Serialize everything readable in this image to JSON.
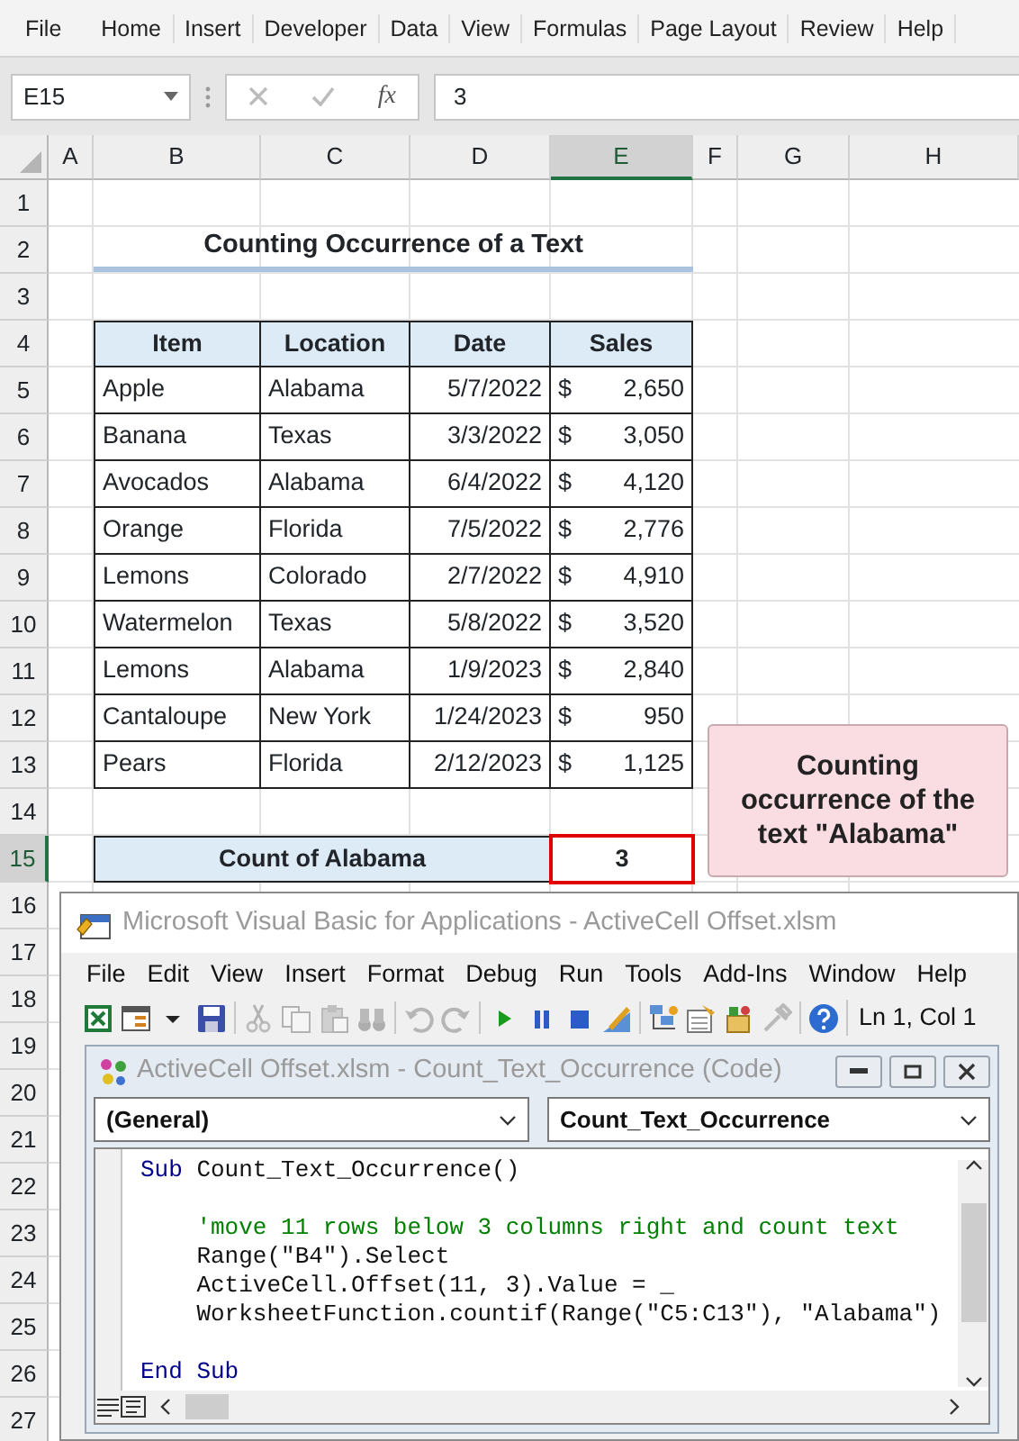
{
  "ribbon_tabs": [
    "File",
    "Home",
    "Insert",
    "Developer",
    "Data",
    "View",
    "Formulas",
    "Page Layout",
    "Review",
    "Help"
  ],
  "formula_bar": {
    "name_box": "E15",
    "fx": "fx",
    "value": "3"
  },
  "columns": [
    {
      "label": "A",
      "selected": false
    },
    {
      "label": "B",
      "selected": false
    },
    {
      "label": "C",
      "selected": false
    },
    {
      "label": "D",
      "selected": false
    },
    {
      "label": "E",
      "selected": true
    },
    {
      "label": "F",
      "selected": false
    },
    {
      "label": "G",
      "selected": false
    },
    {
      "label": "H",
      "selected": false
    }
  ],
  "rows": [
    {
      "label": "1",
      "selected": false
    },
    {
      "label": "2",
      "selected": false
    },
    {
      "label": "3",
      "selected": false
    },
    {
      "label": "4",
      "selected": false
    },
    {
      "label": "5",
      "selected": false
    },
    {
      "label": "6",
      "selected": false
    },
    {
      "label": "7",
      "selected": false
    },
    {
      "label": "8",
      "selected": false
    },
    {
      "label": "9",
      "selected": false
    },
    {
      "label": "10",
      "selected": false
    },
    {
      "label": "11",
      "selected": false
    },
    {
      "label": "12",
      "selected": false
    },
    {
      "label": "13",
      "selected": false
    },
    {
      "label": "14",
      "selected": false
    },
    {
      "label": "15",
      "selected": true
    },
    {
      "label": "16",
      "selected": false
    },
    {
      "label": "17",
      "selected": false
    },
    {
      "label": "18",
      "selected": false
    },
    {
      "label": "19",
      "selected": false
    },
    {
      "label": "20",
      "selected": false
    },
    {
      "label": "21",
      "selected": false
    },
    {
      "label": "22",
      "selected": false
    },
    {
      "label": "23",
      "selected": false
    },
    {
      "label": "24",
      "selected": false
    },
    {
      "label": "25",
      "selected": false
    },
    {
      "label": "26",
      "selected": false
    },
    {
      "label": "27",
      "selected": false
    }
  ],
  "sheet_title": "Counting Occurrence of a Text",
  "table": {
    "columns": [
      "Item",
      "Location",
      "Date",
      "Sales"
    ],
    "rows": [
      {
        "item": "Apple",
        "location": "Alabama",
        "date": "5/7/2022",
        "currency": "$",
        "amount": "2,650"
      },
      {
        "item": "Banana",
        "location": "Texas",
        "date": "3/3/2022",
        "currency": "$",
        "amount": "3,050"
      },
      {
        "item": "Avocados",
        "location": "Alabama",
        "date": "6/4/2022",
        "currency": "$",
        "amount": "4,120"
      },
      {
        "item": "Orange",
        "location": "Florida",
        "date": "7/5/2022",
        "currency": "$",
        "amount": "2,776"
      },
      {
        "item": "Lemons",
        "location": "Colorado",
        "date": "2/7/2022",
        "currency": "$",
        "amount": "4,910"
      },
      {
        "item": "Watermelon",
        "location": "Texas",
        "date": "5/8/2022",
        "currency": "$",
        "amount": "3,520"
      },
      {
        "item": "Lemons",
        "location": "Alabama",
        "date": "1/9/2023",
        "currency": "$",
        "amount": "2,840"
      },
      {
        "item": "Cantaloupe",
        "location": "New York",
        "date": "1/24/2023",
        "currency": "$",
        "amount": "950"
      },
      {
        "item": "Pears",
        "location": "Florida",
        "date": "2/12/2023",
        "currency": "$",
        "amount": "1,125"
      }
    ]
  },
  "summary": {
    "label": "Count of Alabama",
    "value": "3"
  },
  "callout": "Counting occurrence of the text \"Alabama\"",
  "vba_window": {
    "title": "Microsoft Visual Basic for Applications - ActiveCell Offset.xlsm",
    "menu": [
      "File",
      "Edit",
      "View",
      "Insert",
      "Format",
      "Debug",
      "Run",
      "Tools",
      "Add-Ins",
      "Window",
      "Help"
    ],
    "toolbar": [
      [
        {
          "kind": "excel",
          "disabled": false
        },
        {
          "kind": "form",
          "disabled": false
        },
        {
          "kind": "caret",
          "disabled": false
        },
        {
          "kind": "save",
          "disabled": false
        }
      ],
      [
        {
          "kind": "cut",
          "disabled": true
        },
        {
          "kind": "copy",
          "disabled": true
        },
        {
          "kind": "paste",
          "disabled": true
        },
        {
          "kind": "find",
          "disabled": true
        }
      ],
      [
        {
          "kind": "undo",
          "disabled": true
        },
        {
          "kind": "redo",
          "disabled": true
        }
      ],
      [
        {
          "kind": "run",
          "disabled": false
        },
        {
          "kind": "pause",
          "disabled": false
        },
        {
          "kind": "stop",
          "disabled": false
        },
        {
          "kind": "design",
          "disabled": false
        }
      ],
      [
        {
          "kind": "project",
          "disabled": false
        },
        {
          "kind": "properties",
          "disabled": false
        },
        {
          "kind": "browser",
          "disabled": false
        },
        {
          "kind": "toolbox",
          "disabled": true
        }
      ],
      [
        {
          "kind": "help",
          "disabled": false
        }
      ]
    ],
    "position": "Ln 1, Col 1",
    "code_window": {
      "title": "ActiveCell Offset.xlsm - Count_Text_Occurrence (Code)",
      "object": "(General)",
      "procedure": "Count_Text_Occurrence",
      "lines": [
        {
          "kind": "code",
          "tokens": [
            {
              "text": "Sub",
              "kind": "keyword"
            },
            {
              "text": " Count_Text_Occurrence()",
              "kind": "plain"
            }
          ]
        },
        {
          "kind": "blank"
        },
        {
          "kind": "code",
          "tokens": [
            {
              "text": "    'move 11 rows below 3 columns right and count text",
              "kind": "comment"
            }
          ]
        },
        {
          "kind": "code",
          "tokens": [
            {
              "text": "    Range(\"B4\").Select",
              "kind": "plain"
            }
          ]
        },
        {
          "kind": "code",
          "tokens": [
            {
              "text": "    ActiveCell.Offset(11, 3).Value = _",
              "kind": "plain"
            }
          ]
        },
        {
          "kind": "code",
          "tokens": [
            {
              "text": "    WorksheetFunction.countif(Range(\"C5:C13\"), \"Alabama\")",
              "kind": "plain"
            }
          ]
        },
        {
          "kind": "blank"
        },
        {
          "kind": "code",
          "tokens": [
            {
              "text": "End Sub",
              "kind": "keyword"
            }
          ]
        }
      ]
    }
  }
}
